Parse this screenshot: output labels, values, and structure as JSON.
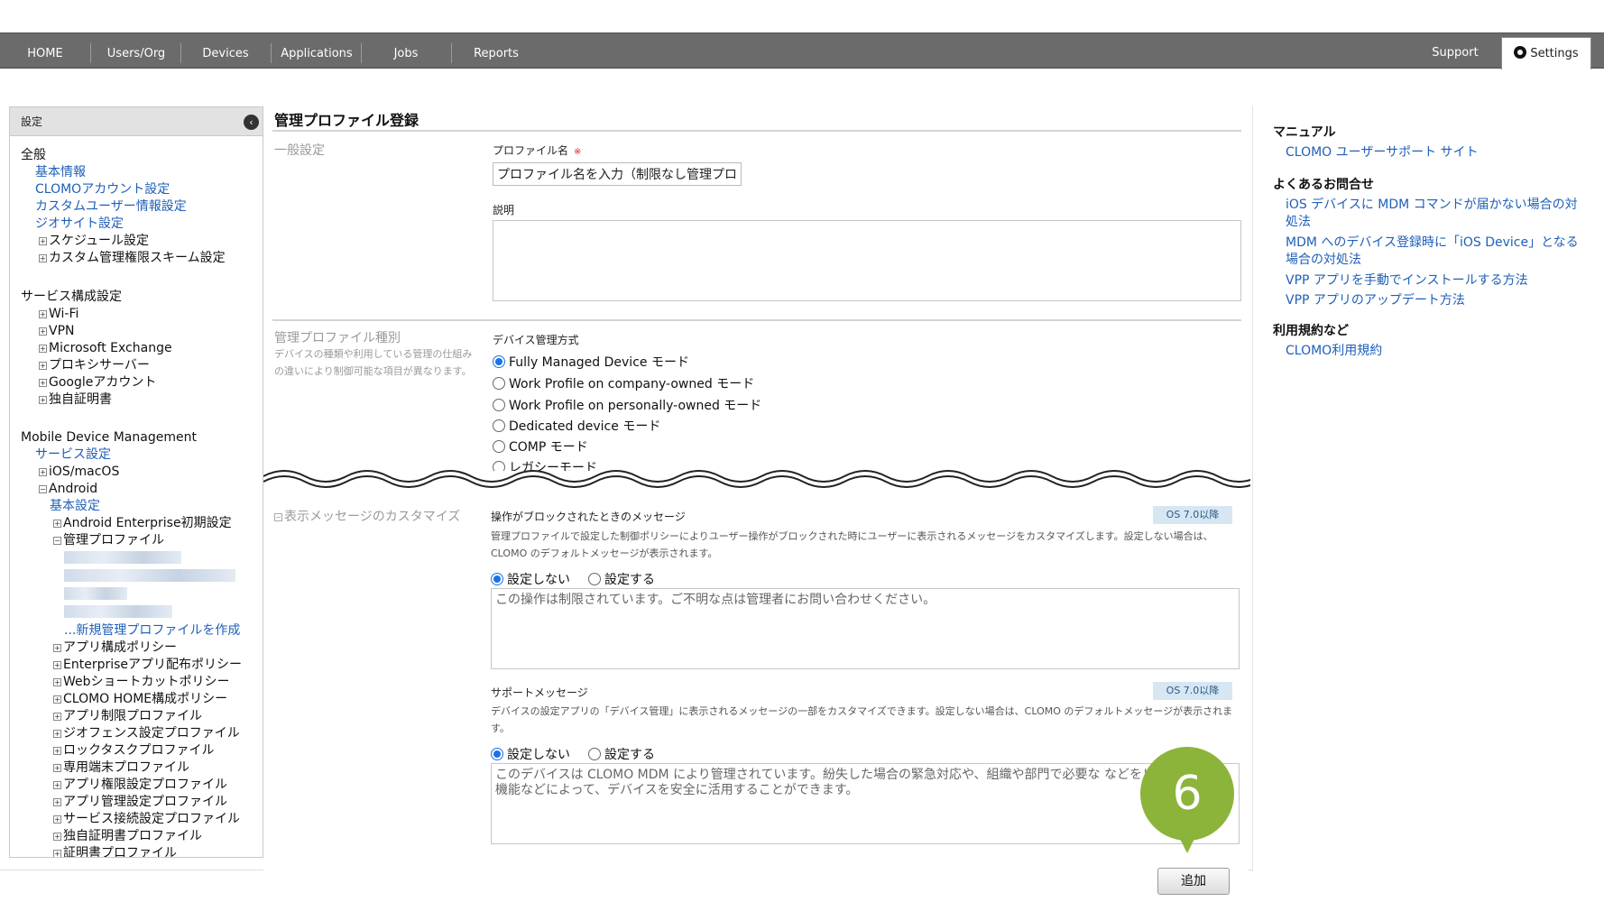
{
  "nav": {
    "items": [
      "HOME",
      "Users/Org",
      "Devices",
      "Applications",
      "Jobs",
      "Reports"
    ],
    "support": "Support",
    "settings": "Settings"
  },
  "sidebar": {
    "header": "設定",
    "general": {
      "title": "全般",
      "links": [
        "基本情報",
        "CLOMOアカウント設定",
        "カスタムユーザー情報設定",
        "ジオサイト設定"
      ],
      "expandables": [
        "スケジュール設定",
        "カスタム管理権限スキーム設定"
      ]
    },
    "service": {
      "title": "サービス構成設定",
      "items": [
        "Wi-Fi",
        "VPN",
        "Microsoft Exchange",
        "プロキシサーバー",
        "Googleアカウント",
        "独自証明書"
      ]
    },
    "mdm": {
      "title": "Mobile Device Management",
      "service_settings": "サービス設定",
      "ios": "iOS/macOS",
      "android": "Android",
      "basic": "基本設定",
      "enterprise_init": "Android Enterprise初期設定",
      "managed_profile": "管理プロファイル",
      "new_profile": "...新規管理プロファイルを作成",
      "items": [
        "アプリ構成ポリシー",
        "Enterpriseアプリ配布ポリシー",
        "Webショートカットポリシー",
        "CLOMO HOME構成ポリシー",
        "アプリ制限プロファイル",
        "ジオフェンス設定プロファイル",
        "ロックタスクプロファイル",
        "専用端末プロファイル",
        "アプリ権限設定プロファイル",
        "アプリ管理設定プロファイル",
        "サービス接続設定プロファイル",
        "独自証明書プロファイル",
        "証明書プロファイル"
      ]
    }
  },
  "main": {
    "title": "管理プロファイル登録",
    "general_section": "一般設定",
    "profile_name_label": "プロファイル名",
    "required_mark": "※",
    "profile_name_value": "プロファイル名を入力（制限なし管理プロ",
    "description_label": "説明",
    "profile_type_section": "管理プロファイル種別",
    "profile_type_desc": "デバイスの種類や利用している管理の仕組みの違いにより制御可能な項目が異なります。",
    "mgmt_method_label": "デバイス管理方式",
    "mgmt_options": [
      "Fully Managed Device モード",
      "Work Profile on company-owned モード",
      "Work Profile on personally-owned モード",
      "Dedicated device モード",
      "COMP モード",
      "レガシーモード"
    ],
    "message_section": "表示メッセージのカスタマイズ",
    "blocked": {
      "label": "操作がブロックされたときのメッセージ",
      "badge": "OS 7.0以降",
      "desc": "管理プロファイルで設定した制御ポリシーによりユーザー操作がブロックされた時にユーザーに表示されるメッセージをカスタマイズします。設定しない場合は、CLOMO のデフォルトメッセージが表示されます。",
      "opt_off": "設定しない",
      "opt_on": "設定する",
      "placeholder": "この操作は制限されています。ご不明な点は管理者にお問い合わせください。"
    },
    "support": {
      "label": "サポートメッセージ",
      "badge": "OS 7.0以降",
      "desc": "デバイスの設定アプリの「デバイス管理」に表示されるメッセージの一部をカスタマイズできます。設定しない場合は、CLOMO のデフォルトメッセージが表示されます。",
      "opt_off": "設定しない",
      "opt_on": "設定する",
      "placeholder": "このデバイスは CLOMO MDM により管理されています。紛失した場合の緊急対応や、組織や部門で必要な などをリモートで行う機能などによって、デバイスを安全に活用することができます。"
    },
    "add_button": "追加"
  },
  "right": {
    "manual_head": "マニュアル",
    "manual_link": "CLOMO ユーザーサポート サイト",
    "faq_head": "よくあるお問合せ",
    "faq_links": [
      "iOS デバイスに MDM コマンドが届かない場合の対処法",
      "MDM へのデバイス登録時に「iOS Device」となる場合の対処法",
      "VPP アプリを手動でインストールする方法",
      "VPP アプリのアップデート方法"
    ],
    "terms_head": "利用規約など",
    "terms_link": "CLOMO利用規約"
  },
  "callout": {
    "number": "6",
    "color": "#8cb43a"
  }
}
